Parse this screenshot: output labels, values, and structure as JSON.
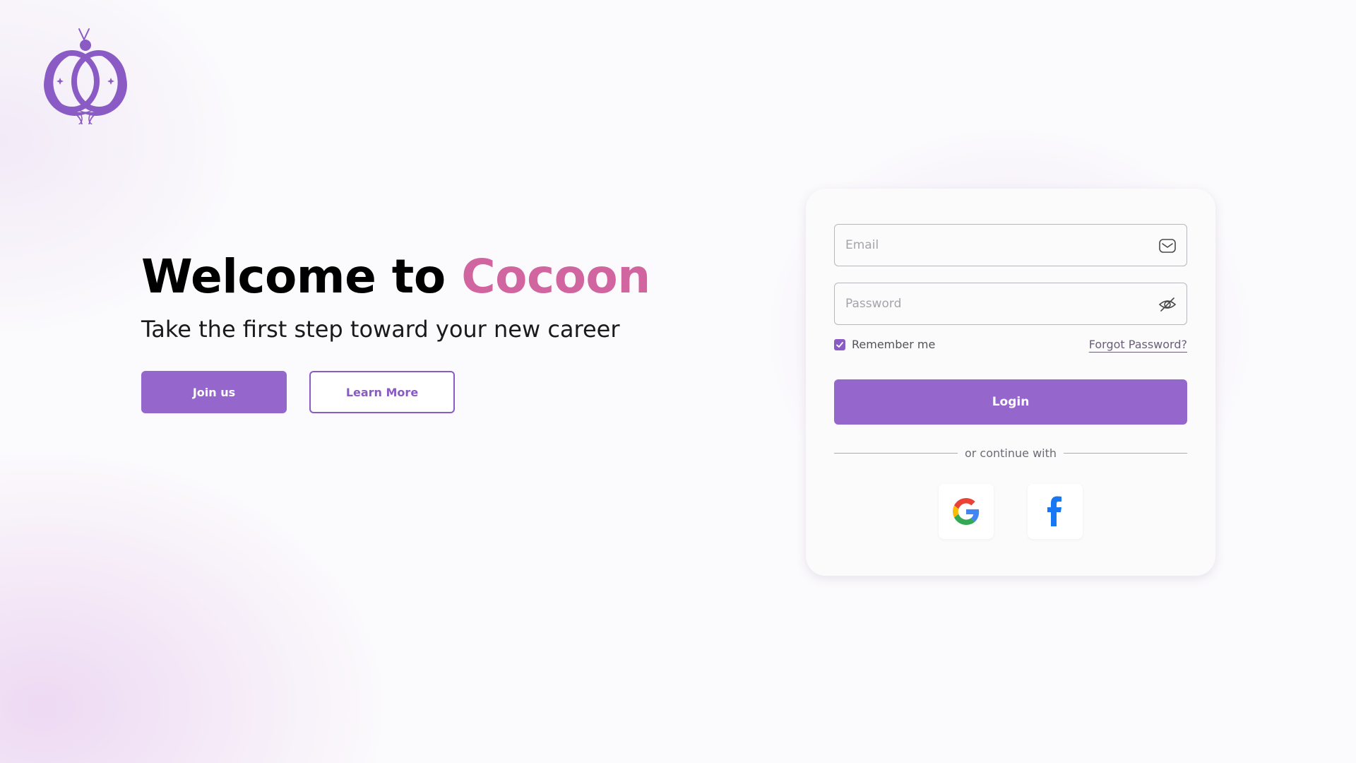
{
  "brand": {
    "logo_icon": "cocoon-butterfly-logo",
    "accent_color": "#9567cd",
    "highlight_color": "#d0659f"
  },
  "hero": {
    "title_prefix": "Welcome to ",
    "title_brand": "Cocoon",
    "subtitle": "Take the first step toward your new career",
    "join_label": "Join us",
    "learn_more_label": "Learn More"
  },
  "login_form": {
    "email_placeholder": "Email",
    "email_value": "",
    "email_icon": "mail-icon",
    "password_placeholder": "Password",
    "password_value": "",
    "password_icon": "eye-off-icon",
    "remember_label": "Remember me",
    "remember_checked": true,
    "forgot_label": "Forgot Password?",
    "login_label": "Login",
    "divider_text": "or continue with",
    "social": [
      {
        "name": "google",
        "icon": "google-icon"
      },
      {
        "name": "facebook",
        "icon": "facebook-icon"
      }
    ]
  }
}
